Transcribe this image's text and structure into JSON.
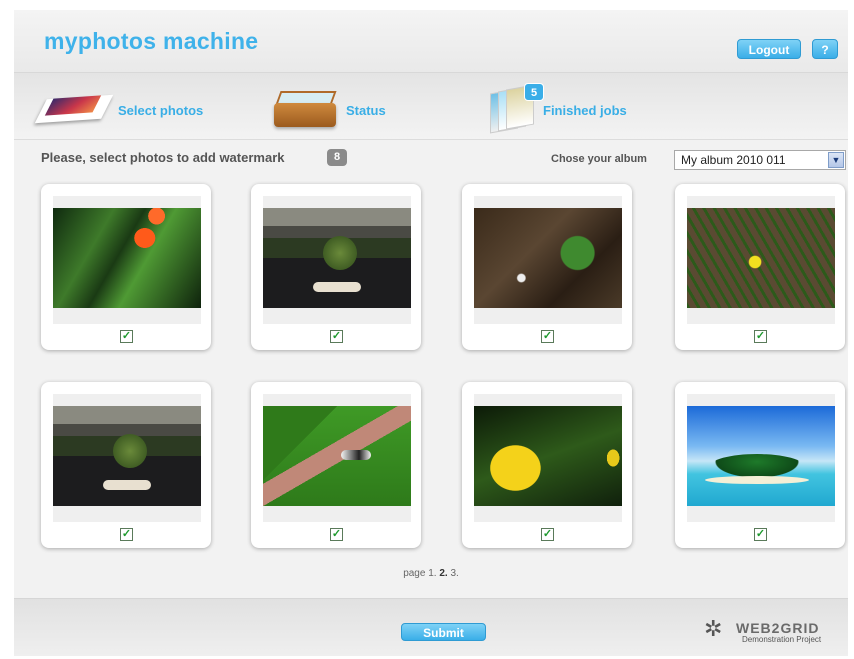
{
  "header": {
    "app_title": "myphotos machine",
    "logout_label": "Logout",
    "help_label": "?"
  },
  "nav": {
    "select_photos": "Select photos",
    "status": "Status",
    "finished_jobs": "Finished jobs",
    "finished_jobs_count": "5"
  },
  "toolbar": {
    "instruction": "Please, select photos to add watermark",
    "selected_count": "8",
    "album_label": "Chose your album",
    "album_value": "My album 2010 011"
  },
  "photos": [
    {
      "subject": "orange tulips",
      "checked": true
    },
    {
      "subject": "garden pond",
      "checked": true
    },
    {
      "subject": "white flower on ground",
      "checked": true
    },
    {
      "subject": "yellow flower in grass",
      "checked": true
    },
    {
      "subject": "garden pond",
      "checked": true
    },
    {
      "subject": "cat on brick path",
      "checked": true
    },
    {
      "subject": "yellow tulip",
      "checked": true
    },
    {
      "subject": "tropical island",
      "checked": true
    }
  ],
  "pager": {
    "prefix": "page",
    "page1": "1.",
    "page2": "2.",
    "page3": "3."
  },
  "footer": {
    "submit_label": "Submit",
    "brand": "WEB2GRID",
    "brand_sub": "Demonstration Project"
  },
  "colors": {
    "accent": "#3aaee8",
    "title": "#3fb2ea"
  }
}
